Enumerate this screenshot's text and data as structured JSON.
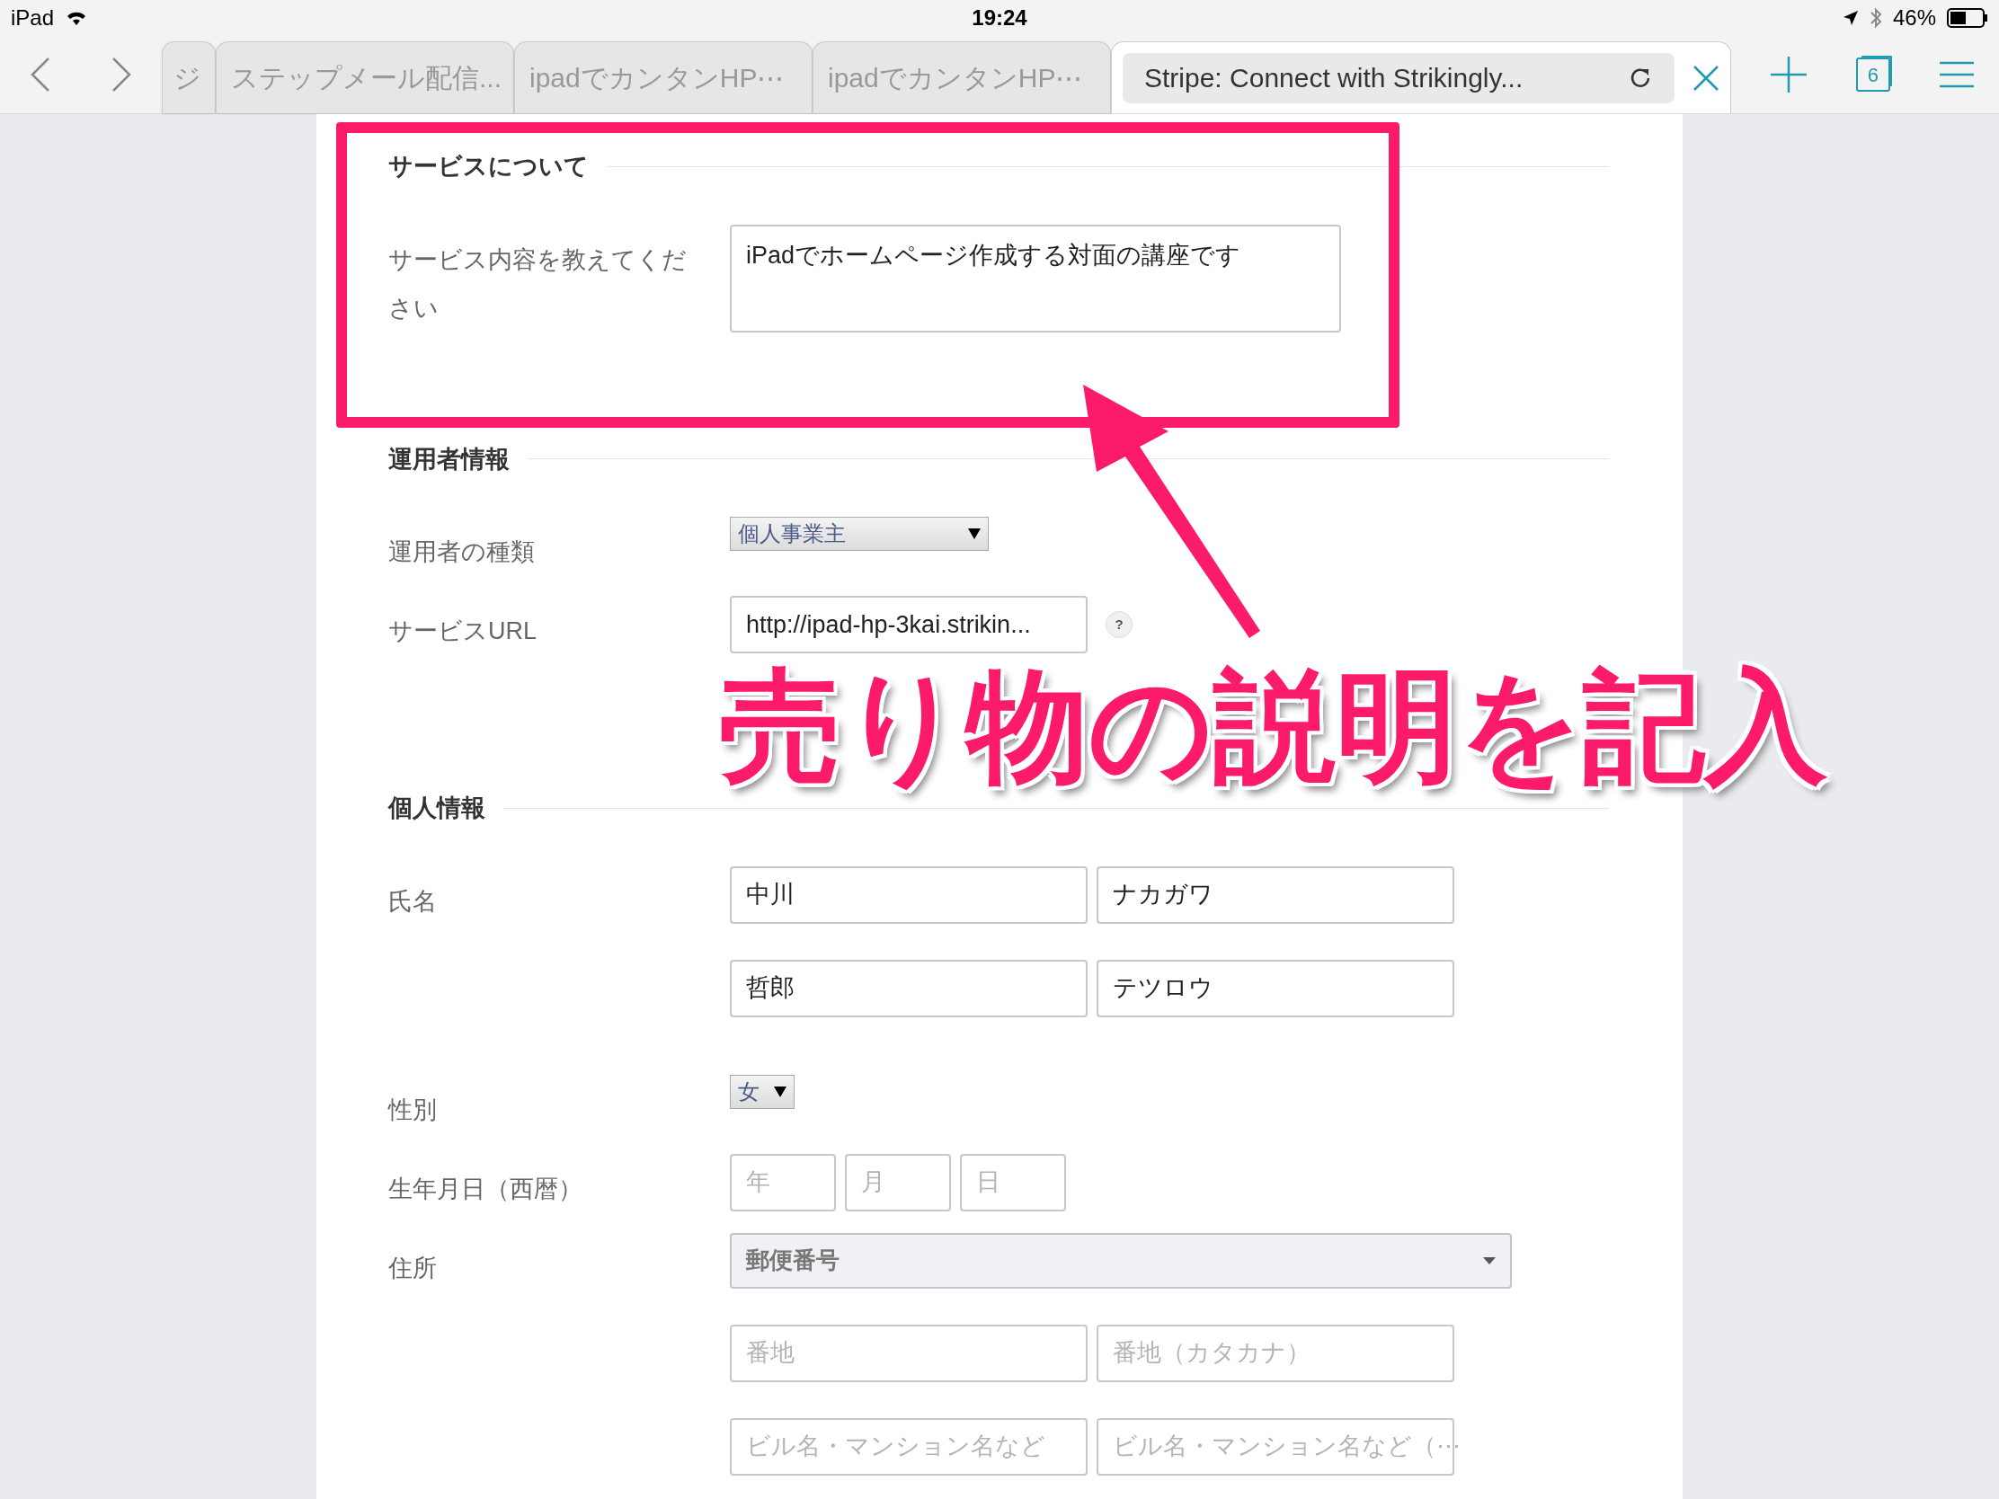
{
  "status_bar": {
    "device": "iPad",
    "time": "19:24",
    "battery": "46%"
  },
  "tabs": [
    {
      "title": "ジ",
      "selected": false
    },
    {
      "title": "ステップメール配信...",
      "selected": false
    },
    {
      "title": "ipadでカンタンHP⋯",
      "selected": false
    },
    {
      "title": "ipadでカンタンHP⋯",
      "selected": false
    },
    {
      "title": "Stripe: Connect with Strikingly...",
      "selected": true
    }
  ],
  "tab_count": "6",
  "sections": [
    {
      "title": "サービスについて",
      "rows": [
        {
          "label": "サービス内容を教えてください",
          "lines": [
            [
              {
                "kind": "textarea",
                "value": "iPadでホームページ作成する対面の講座です"
              }
            ]
          ]
        }
      ]
    },
    {
      "title": "運用者情報",
      "rows": [
        {
          "label": "運用者の種類",
          "lines": [
            [
              {
                "kind": "long-dropdown",
                "value": "個人事業主"
              }
            ]
          ]
        },
        {
          "label": "サービスURL",
          "lines": [
            [
              {
                "kind": "input",
                "value": "http://ipad-hp-3kai.strikin...",
                "help": "?"
              }
            ]
          ]
        }
      ]
    },
    {
      "title": "個人情報",
      "rows": [
        {
          "label": "氏名",
          "lines": [
            [
              {
                "kind": "input",
                "value": "中川"
              },
              {
                "kind": "input",
                "value": "ナカガワ"
              }
            ],
            [
              {
                "kind": "input",
                "value": "哲郎"
              },
              {
                "kind": "input",
                "value": "テツロウ"
              }
            ]
          ]
        },
        {
          "label": "性別",
          "lines": [
            [
              {
                "kind": "dropdown",
                "value": "女"
              }
            ]
          ]
        },
        {
          "label": "生年月日（西暦）",
          "lines": [
            [
              {
                "kind": "short-input",
                "placeholder": "年"
              },
              {
                "kind": "short-input",
                "placeholder": "月"
              },
              {
                "kind": "short-input",
                "placeholder": "日"
              }
            ]
          ]
        },
        {
          "label": "住所",
          "lines": [
            [
              {
                "kind": "wide-select",
                "placeholder": "郵便番号"
              }
            ],
            [
              {
                "kind": "input",
                "placeholder": "番地"
              },
              {
                "kind": "input",
                "placeholder": "番地（カタカナ）"
              }
            ],
            [
              {
                "kind": "input",
                "placeholder": "ビル名・マンション名など"
              },
              {
                "kind": "input",
                "placeholder": "ビル名・マンション名など（⋯"
              }
            ]
          ]
        }
      ]
    }
  ],
  "annotation": {
    "text": "売り物の説明を記入"
  }
}
